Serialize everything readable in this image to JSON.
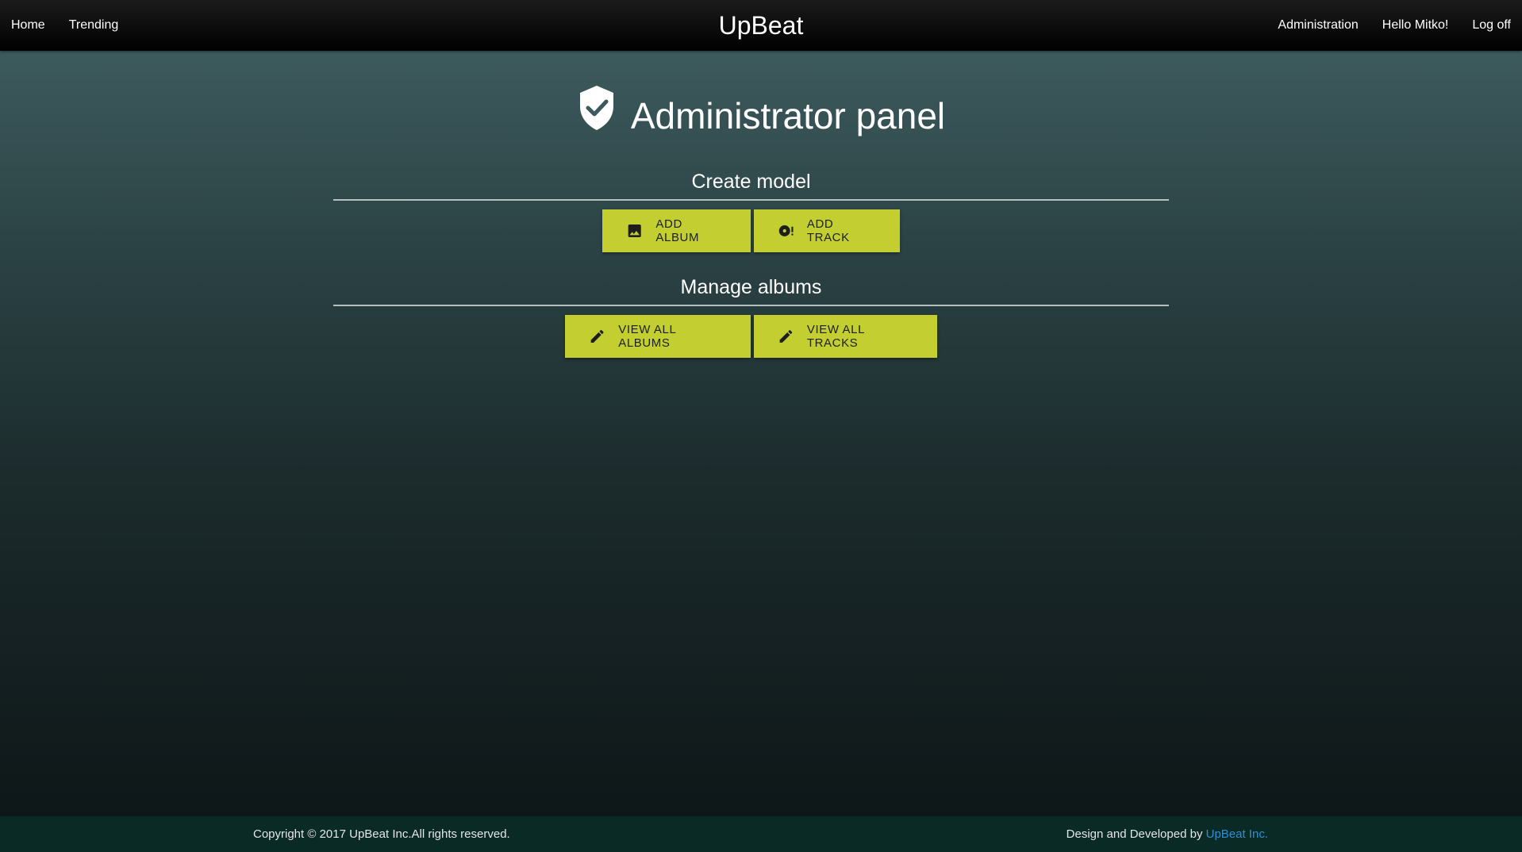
{
  "nav": {
    "left": [
      "Home",
      "Trending"
    ],
    "brand": "UpBeat",
    "right": [
      "Administration",
      "Hello Mitko!",
      "Log off"
    ]
  },
  "heading": {
    "icon": "shield-check-icon",
    "title": "Administrator panel"
  },
  "sections": [
    {
      "title": "Create model",
      "buttons": [
        {
          "label": "ADD ALBUM",
          "icon": "image-icon"
        },
        {
          "label": "ADD TRACK",
          "icon": "disc-alert-icon"
        }
      ]
    },
    {
      "title": "Manage albums",
      "buttons": [
        {
          "label": "VIEW ALL ALBUMS",
          "icon": "pencil-icon"
        },
        {
          "label": "VIEW ALL TRACKS",
          "icon": "pencil-icon"
        }
      ]
    }
  ],
  "footer": {
    "copyright": "Copyright © 2017 UpBeat Inc.All rights reserved.",
    "credit_prefix": "Design and Developed by ",
    "credit_link": "UpBeat Inc."
  },
  "colors": {
    "button": "#c3cf31",
    "navbar": "#000000",
    "footer": "#0a2a26",
    "link": "#2e8fd6"
  }
}
